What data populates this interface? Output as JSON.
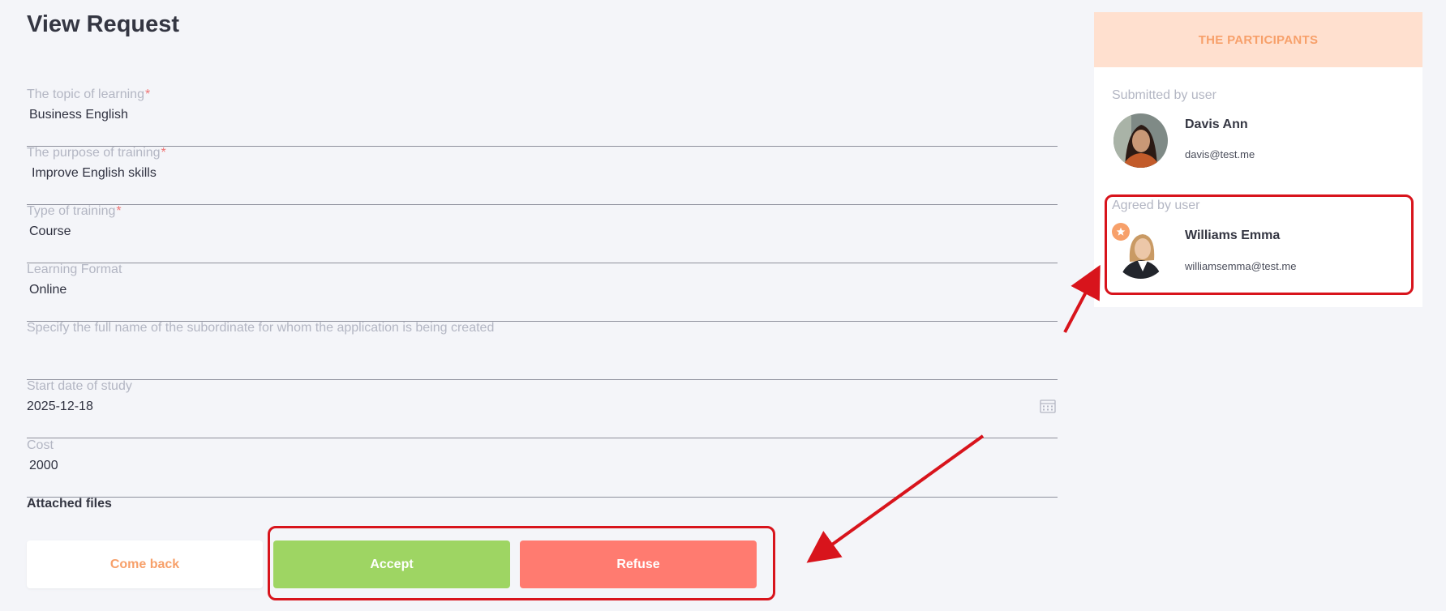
{
  "page": {
    "title": "View Request"
  },
  "form": {
    "topic": {
      "label": "The topic of learning",
      "required": "*",
      "value": "Business English"
    },
    "purpose": {
      "label": "The purpose of training",
      "required": "*",
      "value": "Improve English skills"
    },
    "type": {
      "label": "Type of training",
      "required": "*",
      "value": "Course"
    },
    "format": {
      "label": "Learning Format",
      "value": "Online"
    },
    "subordinate": {
      "label": "Specify the full name of the subordinate for whom the application is being created",
      "value": ""
    },
    "start_date": {
      "label": "Start date of study",
      "value": "2025-12-18",
      "icon": "calendar-icon"
    },
    "cost": {
      "label": "Cost",
      "value": "2000"
    },
    "attached_files_label": "Attached files"
  },
  "actions": {
    "back_label": "Come back",
    "accept_label": "Accept",
    "refuse_label": "Refuse"
  },
  "participants": {
    "header": "THE PARTICIPANTS",
    "submitted": {
      "label": "Submitted by user",
      "name": "Davis Ann",
      "email": "davis@test.me",
      "icon": "avatar"
    },
    "agreed": {
      "label": "Agreed by user",
      "name": "Williams Emma",
      "email": "williamsemma@test.me",
      "icon": "avatar",
      "badge_icon": "star-icon"
    }
  },
  "colors": {
    "accent": "#f7a06a",
    "accept": "#9ed563",
    "refuse": "#ff7b70",
    "panel_header_bg": "#ffe0cf",
    "annotation": "#d8141c"
  }
}
